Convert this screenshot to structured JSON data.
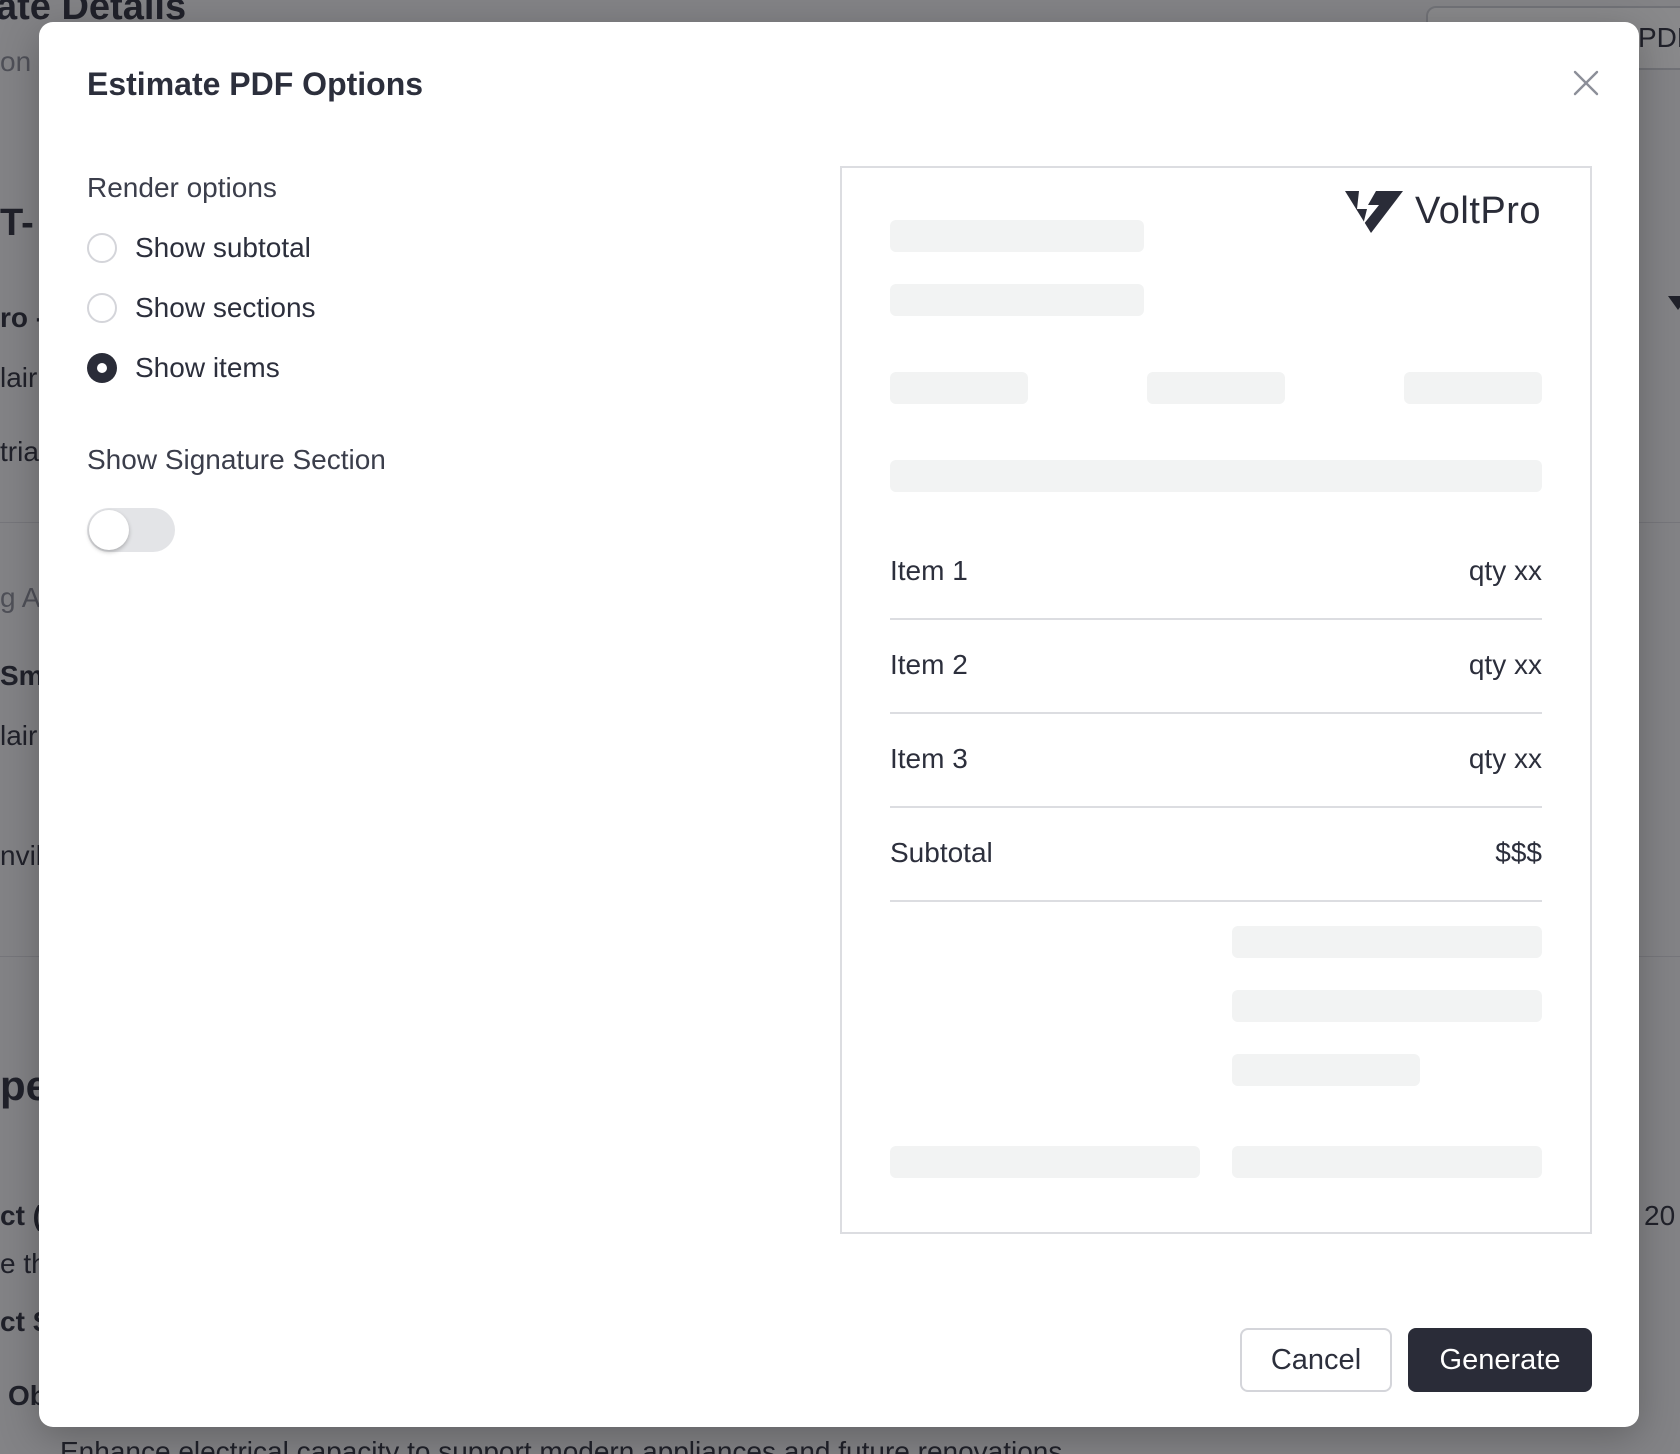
{
  "background": {
    "title_fragment": "ate Details",
    "pdf_button_fragment": "PDF",
    "fragments": [
      "on",
      "T-",
      "ro -",
      "lair",
      "tria",
      "g Ac",
      "Sm",
      "lair",
      "nvill",
      "pe",
      "ct (",
      "e th",
      "ct S",
      "Ob",
      "20"
    ],
    "bottom_line": "Enhance electrical capacity to support modern appliances and future renovations"
  },
  "modal": {
    "title": "Estimate PDF Options",
    "close_icon": "close-icon",
    "render_options": {
      "label": "Render options",
      "options": [
        {
          "label": "Show subtotal",
          "checked": false
        },
        {
          "label": "Show sections",
          "checked": false
        },
        {
          "label": "Show items",
          "checked": true
        }
      ]
    },
    "signature": {
      "label": "Show Signature Section",
      "enabled": false
    },
    "preview": {
      "logo_icon": "voltpro-logo-icon",
      "logo_text": "VoltPro",
      "rows": [
        {
          "label": "Item 1",
          "value": "qty xx"
        },
        {
          "label": "Item 2",
          "value": "qty xx"
        },
        {
          "label": "Item 3",
          "value": "qty xx"
        },
        {
          "label": "Subtotal",
          "value": "$$$"
        }
      ]
    },
    "buttons": {
      "cancel": "Cancel",
      "generate": "Generate"
    }
  },
  "colors": {
    "primary": "#2a2c38",
    "overlay": "rgba(20,20,24,0.5)",
    "placeholder": "#f2f3f3",
    "divider": "#dcdde1"
  }
}
